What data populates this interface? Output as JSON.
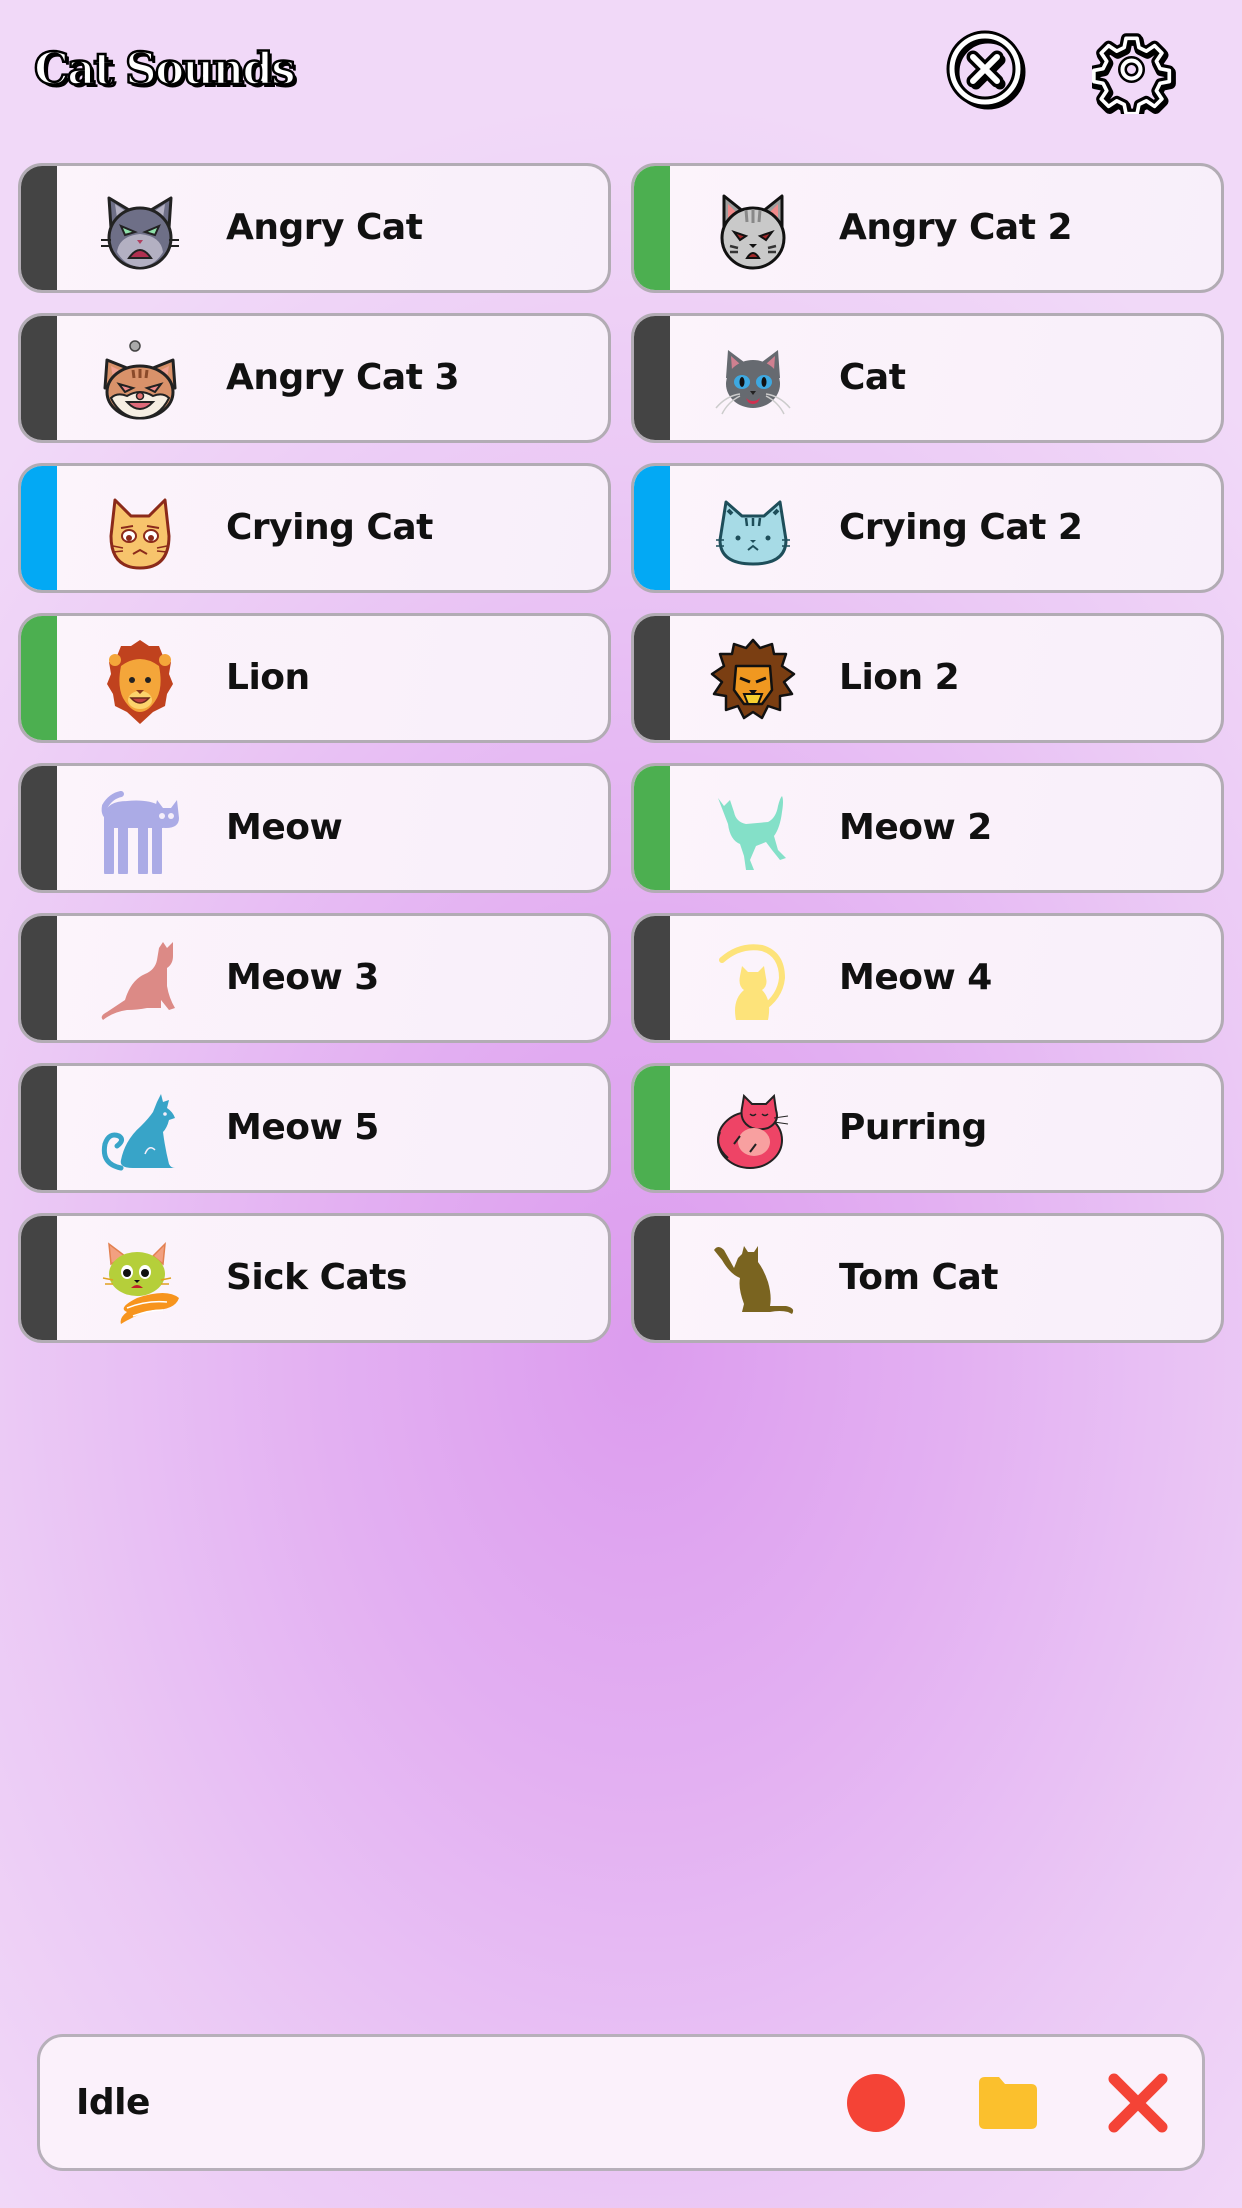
{
  "app": {
    "title": "Cat Sounds"
  },
  "header": {
    "close_icon": "circle-x-icon",
    "settings_icon": "gear-icon"
  },
  "colors": {
    "stripe_default": "#444444",
    "stripe_green": "#4caf50",
    "stripe_blue": "#03a9f4",
    "record": "#f44336",
    "folder": "#fbc02d",
    "stop": "#f44336"
  },
  "sounds": [
    {
      "label": "Angry Cat",
      "icon": "angry-cat-gray-icon",
      "stripe": "#444444"
    },
    {
      "label": "Angry Cat 2",
      "icon": "angry-cat-tabby-icon",
      "stripe": "#4caf50"
    },
    {
      "label": "Angry Cat 3",
      "icon": "angry-cat-orange-icon",
      "stripe": "#444444"
    },
    {
      "label": "Cat",
      "icon": "siamese-cat-icon",
      "stripe": "#444444"
    },
    {
      "label": "Crying Cat",
      "icon": "crying-cat-yellow-icon",
      "stripe": "#03a9f4"
    },
    {
      "label": "Crying Cat 2",
      "icon": "crying-cat-blue-icon",
      "stripe": "#03a9f4"
    },
    {
      "label": "Lion",
      "icon": "lion-cartoon-icon",
      "stripe": "#4caf50"
    },
    {
      "label": "Lion 2",
      "icon": "lion-mane-icon",
      "stripe": "#444444"
    },
    {
      "label": "Meow",
      "icon": "arched-cat-lavender-icon",
      "stripe": "#444444"
    },
    {
      "label": "Meow 2",
      "icon": "walking-cat-mint-icon",
      "stripe": "#4caf50"
    },
    {
      "label": "Meow 3",
      "icon": "sitting-cat-pink-icon",
      "stripe": "#444444"
    },
    {
      "label": "Meow 4",
      "icon": "moon-cat-yellow-icon",
      "stripe": "#444444"
    },
    {
      "label": "Meow 5",
      "icon": "sitting-cat-teal-icon",
      "stripe": "#444444"
    },
    {
      "label": "Purring",
      "icon": "curled-cat-pink-icon",
      "stripe": "#4caf50"
    },
    {
      "label": "Sick Cats",
      "icon": "sick-cat-green-icon",
      "stripe": "#444444"
    },
    {
      "label": "Tom Cat",
      "icon": "pawing-cat-olive-icon",
      "stripe": "#444444"
    }
  ],
  "status": {
    "text": "Idle",
    "record_icon": "record-icon",
    "folder_icon": "folder-icon",
    "stop_icon": "close-x-icon"
  }
}
